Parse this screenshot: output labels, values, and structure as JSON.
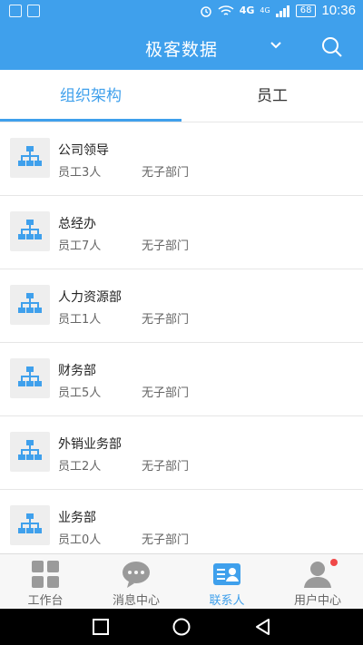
{
  "status_bar": {
    "network": "4G",
    "network_small": "4G",
    "battery": "68",
    "time": "10:36"
  },
  "app_bar": {
    "title": "极客数据",
    "icons": [
      "chevron-down-icon",
      "search-icon"
    ]
  },
  "tabs": [
    {
      "label": "组织架构",
      "active": true
    },
    {
      "label": "员工",
      "active": false
    }
  ],
  "departments": [
    {
      "name": "公司领导",
      "count": "员工3人",
      "subdept": "无子部门"
    },
    {
      "name": "总经办",
      "count": "员工7人",
      "subdept": "无子部门"
    },
    {
      "name": "人力资源部",
      "count": "员工1人",
      "subdept": "无子部门"
    },
    {
      "name": "财务部",
      "count": "员工5人",
      "subdept": "无子部门"
    },
    {
      "name": "外销业务部",
      "count": "员工2人",
      "subdept": "无子部门"
    },
    {
      "name": "业务部",
      "count": "员工0人",
      "subdept": "无子部门"
    }
  ],
  "bottom_nav": [
    {
      "label": "工作台",
      "icon": "grid-icon",
      "active": false
    },
    {
      "label": "消息中心",
      "icon": "chat-icon",
      "active": false
    },
    {
      "label": "联系人",
      "icon": "contact-card-icon",
      "active": true
    },
    {
      "label": "用户中心",
      "icon": "user-icon",
      "active": false,
      "badge": true
    }
  ],
  "colors": {
    "primary": "#3fa0ec",
    "badge": "#f04848"
  }
}
